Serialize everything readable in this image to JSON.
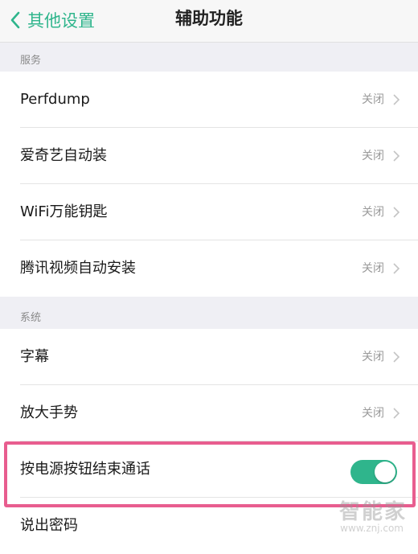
{
  "nav": {
    "back_label": "其他设置",
    "title": "辅助功能"
  },
  "sections": [
    {
      "header": "服务",
      "items": [
        {
          "label": "Perfdump",
          "value": "关闭"
        },
        {
          "label": "爱奇艺自动装",
          "value": "关闭"
        },
        {
          "label": "WiFi万能钥匙",
          "value": "关闭"
        },
        {
          "label": "腾讯视频自动安装",
          "value": "关闭"
        }
      ]
    },
    {
      "header": "系统",
      "items": [
        {
          "label": "字幕",
          "value": "关闭"
        },
        {
          "label": "放大手势",
          "value": "关闭"
        },
        {
          "label": "按电源按钮结束通话",
          "toggle_on": true
        },
        {
          "label": "说出密码"
        }
      ]
    }
  ],
  "watermark": {
    "text": "智能家",
    "url": "www.znj.com"
  },
  "colors": {
    "accent": "#2fb58c",
    "highlight": "#e85d8f"
  }
}
